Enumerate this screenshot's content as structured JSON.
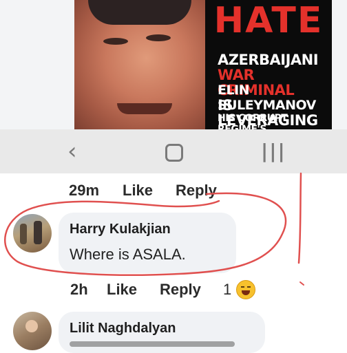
{
  "post_image": {
    "poster_lines": [
      "HATE",
      "AZERBAIJANI",
      "WAR CRIMINAL",
      "ELIN SULEYMANOV",
      "IS LEVERAGING",
      "HIS CORRUPT REGIME'S"
    ]
  },
  "nav_bar": {
    "back_icon": "chevron-left-icon",
    "home_icon": "home-outline-icon",
    "recents_icon": "recents-icon"
  },
  "comments": [
    {
      "time": "29m",
      "like": "Like",
      "reply": "Reply"
    },
    {
      "author": "Harry Kulakjian",
      "text": "Where is ASALA.",
      "time": "2h",
      "like": "Like",
      "reply": "Reply",
      "reaction_count": "1"
    },
    {
      "author": "Lilit Naghdalyan"
    }
  ],
  "colors": {
    "annotation": "#e0504f",
    "poster_red": "#e4312b",
    "bubble": "#f0f2f5"
  }
}
